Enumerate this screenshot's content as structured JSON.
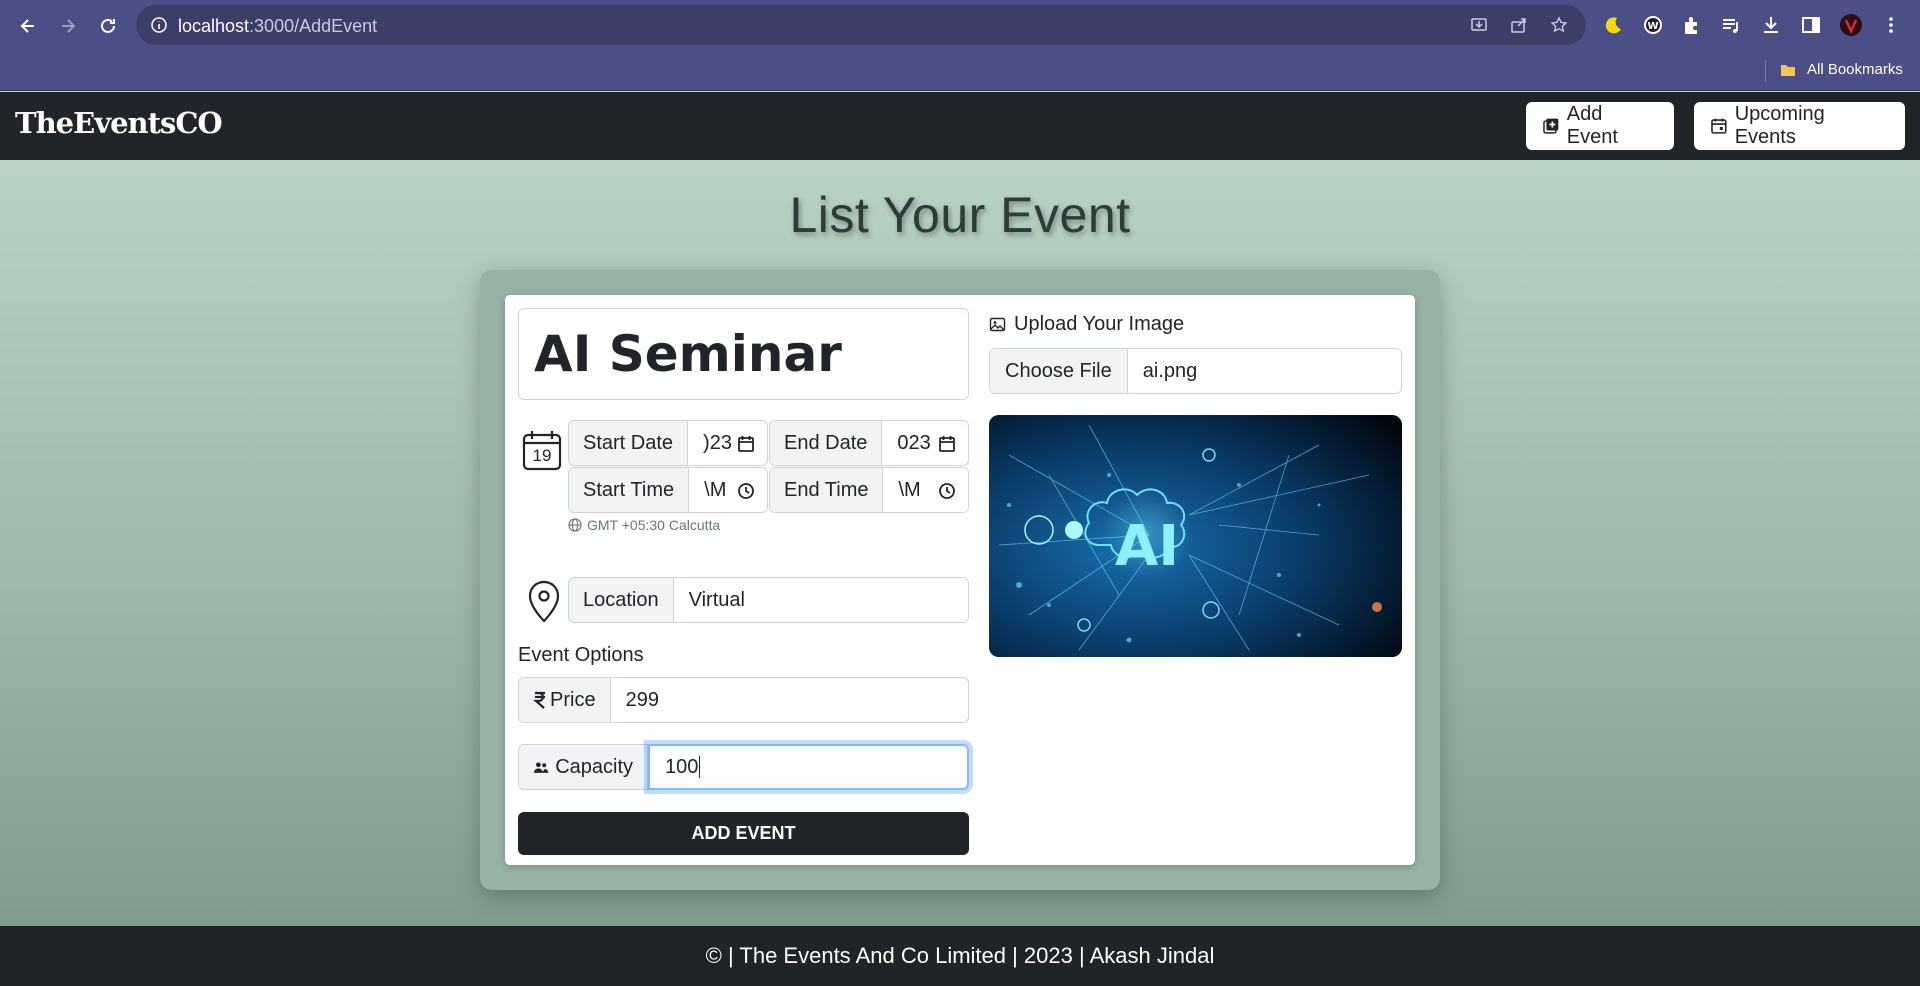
{
  "browser": {
    "url_host": "localhost",
    "url_path": ":3000/AddEvent",
    "bookmarks_label": "All Bookmarks"
  },
  "app": {
    "brand": "TheEventsCO",
    "nav": {
      "add_event": "Add Event",
      "upcoming_events": "Upcoming Events"
    }
  },
  "page": {
    "title": "List Your Event"
  },
  "form": {
    "event_title": "AI Seminar",
    "calendar_day": "19",
    "start_date_label": "Start Date",
    "start_date_value": ")23",
    "end_date_label": "End Date",
    "end_date_value": "023",
    "start_time_label": "Start Time",
    "start_time_value": "\\M",
    "end_time_label": "End Time",
    "end_time_value": "\\M",
    "timezone": "GMT +05:30 Calcutta",
    "location_label": "Location",
    "location_value": "Virtual",
    "options_label": "Event Options",
    "price_label": "Price",
    "price_value": "299",
    "capacity_label": "Capacity",
    "capacity_value": "100",
    "submit_label": "ADD EVENT",
    "upload_label": "Upload Your Image",
    "choose_file_label": "Choose File",
    "file_name": "ai.png",
    "preview_text": "AI"
  },
  "footer": {
    "text": "© | The Events And Co Limited | 2023 | Akash Jindal"
  },
  "colors": {
    "chrome": "#4c4f85",
    "navbar": "#212529",
    "background_top": "#b8d3c4",
    "background_bottom": "#809c8f",
    "focus_ring": "#86b7fe"
  }
}
